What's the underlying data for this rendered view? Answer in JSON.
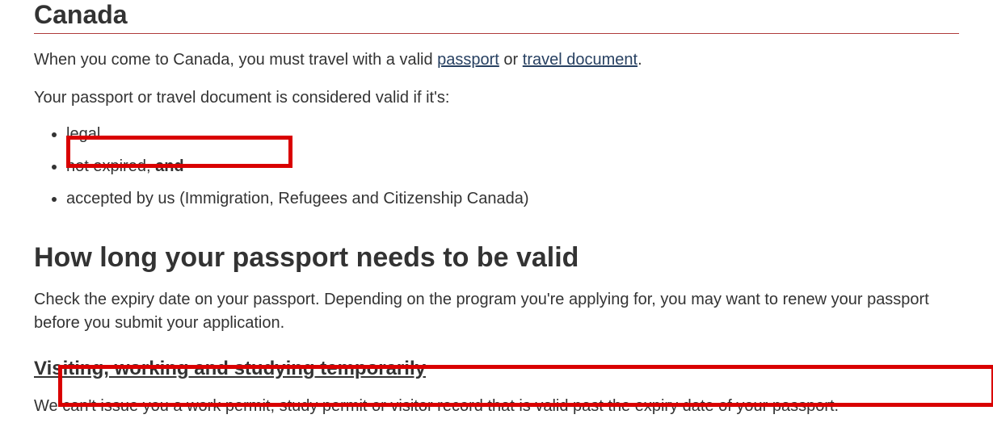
{
  "title": "Canada",
  "intro": {
    "prefix": "When you come to Canada, you must travel with a valid ",
    "link1": "passport",
    "mid": " or ",
    "link2": "travel document",
    "suffix": "."
  },
  "validIntro": "Your passport or travel document is considered valid if it's:",
  "bullets": {
    "b1": "legal",
    "b2_prefix": "not expired, ",
    "b2_bold": "and",
    "b3": "accepted by us (Immigration, Refugees and Citizenship Canada)"
  },
  "heading2": "How long your passport needs to be valid",
  "p2": "Check the expiry date on your passport. Depending on the program you're applying for, you may want to renew your passport before you submit your application.",
  "subheading": "Visiting, working and studying temporarily",
  "p3": "We can't issue you a work permit, study permit or visitor record that is valid past the expiry date of your passport."
}
